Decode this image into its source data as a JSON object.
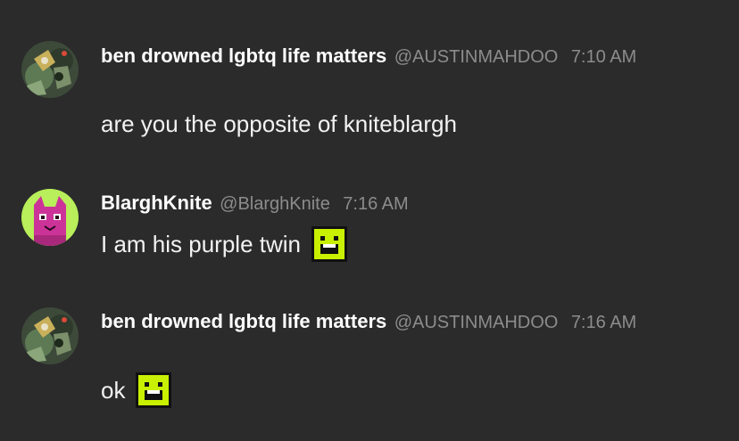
{
  "messages": [
    {
      "username": "ben drowned lgbtq life matters",
      "handle": "@AUSTINMAHDOO",
      "time": "7:10 AM",
      "text": "are you the opposite of kniteblargh",
      "avatar_icon": "ben-drowned-avatar-icon",
      "emoji": ""
    },
    {
      "username": "BlarghKnite",
      "handle": "@BlarghKnite",
      "time": "7:16 AM",
      "text": "I am his purple twin",
      "avatar_icon": "purple-cat-avatar-icon",
      "emoji": "green-smiley-emoji-icon"
    },
    {
      "username": "ben drowned lgbtq life matters",
      "handle": "@AUSTINMAHDOO",
      "time": "7:16 AM",
      "text": "ok",
      "avatar_icon": "ben-drowned-avatar-icon",
      "emoji": "green-smiley-emoji-icon"
    }
  ],
  "colors": {
    "background": "#2b2b2b",
    "username": "#ffffff",
    "meta": "#8c8c8c",
    "text": "#f2f2f2",
    "emoji_green": "#c8f000",
    "avatar_lime": "#b8ef5a",
    "avatar_purple": "#cc3399"
  }
}
